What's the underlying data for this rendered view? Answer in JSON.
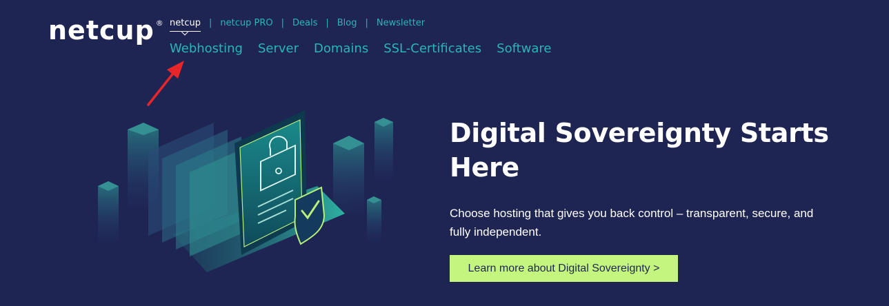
{
  "logo": {
    "text": "netcup",
    "mark": "®"
  },
  "top_nav": {
    "items": [
      {
        "label": "netcup",
        "active": true
      },
      {
        "label": "netcup PRO",
        "active": false
      },
      {
        "label": "Deals",
        "active": false
      },
      {
        "label": "Blog",
        "active": false
      },
      {
        "label": "Newsletter",
        "active": false
      }
    ],
    "separator": "|"
  },
  "main_nav": {
    "items": [
      {
        "label": "Webhosting"
      },
      {
        "label": "Server"
      },
      {
        "label": "Domains"
      },
      {
        "label": "SSL-Certificates"
      },
      {
        "label": "Software"
      }
    ]
  },
  "hero": {
    "headline": "Digital Sovereignty Starts Here",
    "subtext": "Choose hosting that gives you back control – transparent, secure, and fully independent.",
    "cta_label": "Learn more about Digital Sovereignty >"
  },
  "annotation": {
    "icon": "red-arrow-icon",
    "color": "#e8262a"
  },
  "colors": {
    "background": "#1f2552",
    "accent": "#2bb5b5",
    "cta_background": "#c4f57f",
    "text": "#ffffff"
  }
}
